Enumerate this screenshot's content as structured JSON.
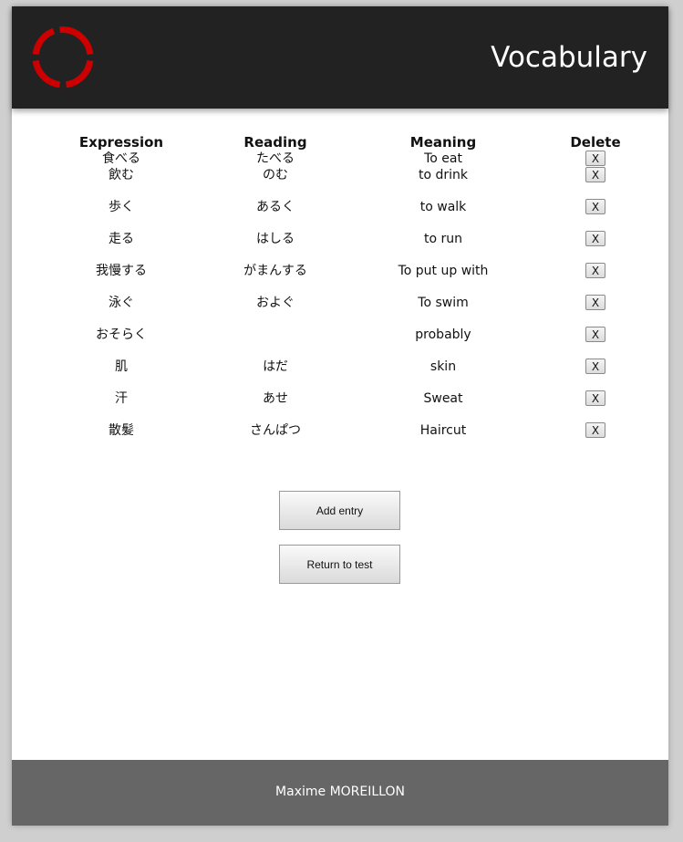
{
  "header": {
    "title": "Vocabulary",
    "logo_icon": "red-ring-logo-icon",
    "logo_color": "#cc0000"
  },
  "table": {
    "columns": [
      "Expression",
      "Reading",
      "Meaning",
      "Delete"
    ],
    "delete_label": "X",
    "rows": [
      {
        "expression": "食べる",
        "reading": "たべる",
        "meaning": "To eat"
      },
      {
        "expression": "飲む",
        "reading": "のむ",
        "meaning": "to drink"
      },
      {
        "expression": "歩く",
        "reading": "あるく",
        "meaning": "to walk"
      },
      {
        "expression": "走る",
        "reading": "はしる",
        "meaning": "to run"
      },
      {
        "expression": "我慢する",
        "reading": "がまんする",
        "meaning": "To put up with"
      },
      {
        "expression": "泳ぐ",
        "reading": "およぐ",
        "meaning": "To swim"
      },
      {
        "expression": "おそらく",
        "reading": "",
        "meaning": "probably"
      },
      {
        "expression": "肌",
        "reading": "はだ",
        "meaning": "skin"
      },
      {
        "expression": "汗",
        "reading": "あせ",
        "meaning": "Sweat"
      },
      {
        "expression": "散髪",
        "reading": "さんぱつ",
        "meaning": "Haircut"
      }
    ]
  },
  "buttons": {
    "add_entry": "Add entry",
    "return_to_test": "Return to test"
  },
  "footer": {
    "text": "Maxime MOREILLON"
  }
}
